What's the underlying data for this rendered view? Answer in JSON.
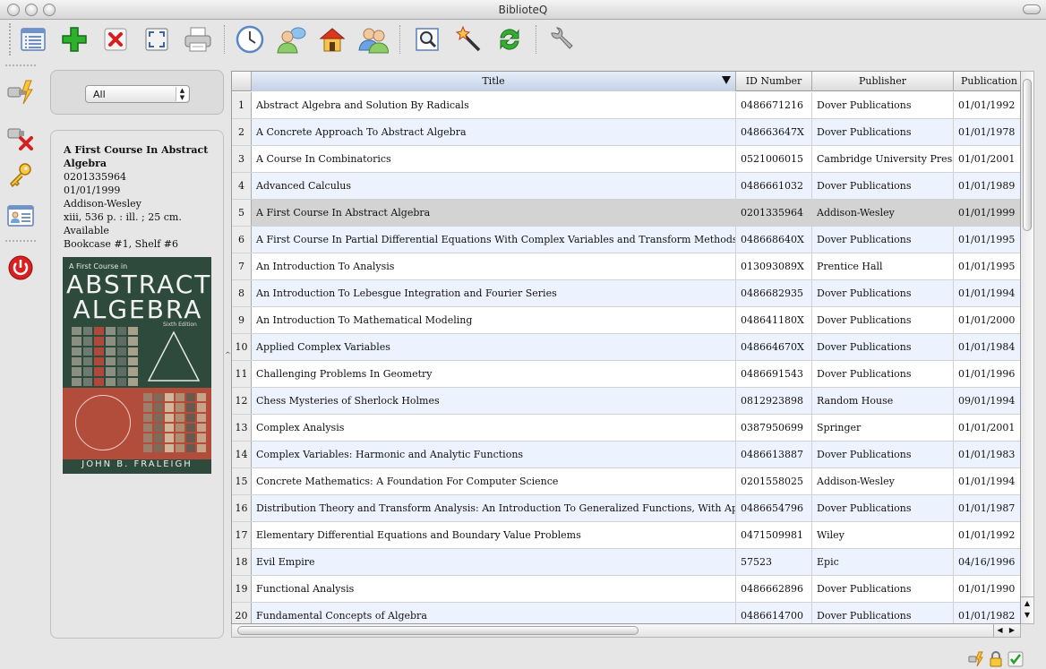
{
  "window": {
    "title": "BiblioteQ"
  },
  "toolbar": {
    "buttons": [
      {
        "icon": "list-view-icon",
        "label": ""
      },
      {
        "icon": "add-icon",
        "label": ""
      },
      {
        "icon": "delete-icon",
        "label": ""
      },
      {
        "icon": "fullscreen-icon",
        "label": ""
      },
      {
        "icon": "print-icon",
        "label": ""
      },
      {
        "icon": "clock-icon",
        "label": ""
      },
      {
        "icon": "user-chat-icon",
        "label": ""
      },
      {
        "icon": "home-icon",
        "label": ""
      },
      {
        "icon": "users-icon",
        "label": ""
      },
      {
        "icon": "search-icon",
        "label": ""
      },
      {
        "icon": "magic-wand-icon",
        "label": ""
      },
      {
        "icon": "refresh-icon",
        "label": ""
      },
      {
        "icon": "wrench-icon",
        "label": ""
      }
    ]
  },
  "sidebar": {
    "icons": [
      "connect-icon",
      "disconnect-icon",
      "key-icon",
      "profile-card-icon",
      "power-icon"
    ]
  },
  "filter": {
    "selected": "All"
  },
  "detail": {
    "title": "A First Course In Abstract Algebra",
    "id": "0201335964",
    "date": "01/01/1999",
    "publisher": "Addison-Wesley",
    "physical": "xiii, 536 p. : ill. ; 25 cm.",
    "availability": "Available",
    "location": "Bookcase #1, Shelf #6",
    "cover": {
      "small": "A First Course in",
      "line1": "ABSTRACT",
      "line2": "ALGEBRA",
      "edition": "Sixth Edition",
      "author": "JOHN B. FRALEIGH"
    }
  },
  "table": {
    "columns": [
      "",
      "Title",
      "ID Number",
      "Publisher",
      "Publication D"
    ],
    "selected_row": 5,
    "rows": [
      {
        "n": "1",
        "title": "Abstract Algebra and Solution By Radicals",
        "id": "0486671216",
        "publisher": "Dover Publications",
        "date": "01/01/1992"
      },
      {
        "n": "2",
        "title": "A Concrete Approach To Abstract Algebra",
        "id": "048663647X",
        "publisher": "Dover Publications",
        "date": "01/01/1978"
      },
      {
        "n": "3",
        "title": "A Course In Combinatorics",
        "id": "0521006015",
        "publisher": "Cambridge University Press",
        "date": "01/01/2001"
      },
      {
        "n": "4",
        "title": "Advanced Calculus",
        "id": "0486661032",
        "publisher": "Dover Publications",
        "date": "01/01/1989"
      },
      {
        "n": "5",
        "title": "A First Course In Abstract Algebra",
        "id": "0201335964",
        "publisher": "Addison-Wesley",
        "date": "01/01/1999"
      },
      {
        "n": "6",
        "title": "A First Course In Partial Differential Equations With Complex Variables and Transform Methods",
        "id": "048668640X",
        "publisher": "Dover Publications",
        "date": "01/01/1995"
      },
      {
        "n": "7",
        "title": "An Introduction To Analysis",
        "id": "013093089X",
        "publisher": "Prentice Hall",
        "date": "01/01/1995"
      },
      {
        "n": "8",
        "title": "An Introduction To Lebesgue Integration and Fourier Series",
        "id": "0486682935",
        "publisher": "Dover Publications",
        "date": "01/01/1994"
      },
      {
        "n": "9",
        "title": "An Introduction To Mathematical Modeling",
        "id": "048641180X",
        "publisher": "Dover Publications",
        "date": "01/01/2000"
      },
      {
        "n": "10",
        "title": "Applied Complex Variables",
        "id": "048664670X",
        "publisher": "Dover Publications",
        "date": "01/01/1984"
      },
      {
        "n": "11",
        "title": "Challenging Problems In Geometry",
        "id": "0486691543",
        "publisher": "Dover Publications",
        "date": "01/01/1996"
      },
      {
        "n": "12",
        "title": "Chess Mysteries of Sherlock Holmes",
        "id": "0812923898",
        "publisher": "Random House",
        "date": "09/01/1994"
      },
      {
        "n": "13",
        "title": "Complex Analysis",
        "id": "0387950699",
        "publisher": "Springer",
        "date": "01/01/2001"
      },
      {
        "n": "14",
        "title": "Complex Variables: Harmonic and Analytic Functions",
        "id": "0486613887",
        "publisher": "Dover Publications",
        "date": "01/01/1983"
      },
      {
        "n": "15",
        "title": "Concrete Mathematics: A Foundation For Computer Science",
        "id": "0201558025",
        "publisher": "Addison-Wesley",
        "date": "01/01/1994"
      },
      {
        "n": "16",
        "title": "Distribution Theory and Transform Analysis: An Introduction To Generalized Functions, With Applications",
        "id": "0486654796",
        "publisher": "Dover Publications",
        "date": "01/01/1987"
      },
      {
        "n": "17",
        "title": "Elementary Differential Equations and Boundary Value Problems",
        "id": "0471509981",
        "publisher": "Wiley",
        "date": "01/01/1992"
      },
      {
        "n": "18",
        "title": "Evil Empire",
        "id": "57523",
        "publisher": "Epic",
        "date": "04/16/1996"
      },
      {
        "n": "19",
        "title": "Functional Analysis",
        "id": "0486662896",
        "publisher": "Dover Publications",
        "date": "01/01/1990"
      },
      {
        "n": "20",
        "title": "Fundamental Concepts of Algebra",
        "id": "0486614700",
        "publisher": "Dover Publications",
        "date": "01/01/1982"
      }
    ]
  },
  "statusbar": {
    "icons": [
      "connection-status-icon",
      "lock-icon",
      "checkmark-icon"
    ]
  }
}
